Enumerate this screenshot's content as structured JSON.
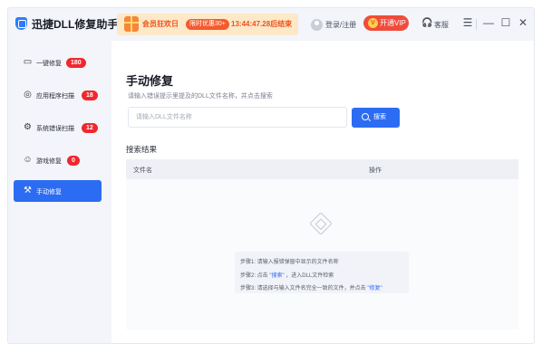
{
  "app": {
    "title": "迅捷DLL修复助手"
  },
  "promo": {
    "text": "会员狂欢日",
    "badge": "限时优惠30+",
    "countdown": "13:44:47.28后结束"
  },
  "header": {
    "login_label": "登录/注册",
    "vip_label": "开通VIP",
    "vip_icon_text": "V",
    "feedback_label": "客服",
    "headset_icon": "headset-icon",
    "controls": [
      "menu-icon",
      "minimize-icon",
      "maximize-icon",
      "close-icon"
    ],
    "menu_glyph": "☰",
    "min_glyph": "—",
    "max_glyph": "☐",
    "close_glyph": "✕"
  },
  "sidebar": {
    "items": [
      {
        "label": "一键修复",
        "badge": "180",
        "icon": "monitor-icon",
        "glyph": "▭",
        "active": false
      },
      {
        "label": "应用程序扫描",
        "badge": "18",
        "icon": "app-scan-icon",
        "glyph": "◎",
        "active": false
      },
      {
        "label": "系统错误扫描",
        "badge": "12",
        "icon": "gear-icon",
        "glyph": "⚙",
        "active": false
      },
      {
        "label": "游戏修复",
        "badge": "0",
        "icon": "gamepad-icon",
        "glyph": "☺",
        "active": false
      },
      {
        "label": "手动修复",
        "badge": "",
        "icon": "wrench-icon",
        "glyph": "🔧",
        "active": true
      }
    ]
  },
  "main": {
    "title": "手动修复",
    "description": "请输入错误提示里提及的DLL文件名称，并点击搜索",
    "search": {
      "placeholder": "请输入DLL文件名称",
      "button_label": "搜索"
    },
    "results_title": "搜索结果",
    "columns": [
      "文件名",
      "操作"
    ],
    "steps": {
      "step1": "步骤1: 请输入报错弹窗中显示的文件名称",
      "step2_prefix": "步骤2: 点击",
      "step2_link": "\"搜索\"",
      "step2_suffix": "，进入DLL文件检索",
      "step3_prefix": "步骤3: 请选择与输入文件名完全一致的文件，并点击",
      "step3_link": "\"修复\""
    }
  },
  "colors": {
    "accent": "#2c6cf2",
    "badge_red": "#f0282d",
    "vip_red": "#f04c3c",
    "promo_orange": "#e8541b"
  }
}
